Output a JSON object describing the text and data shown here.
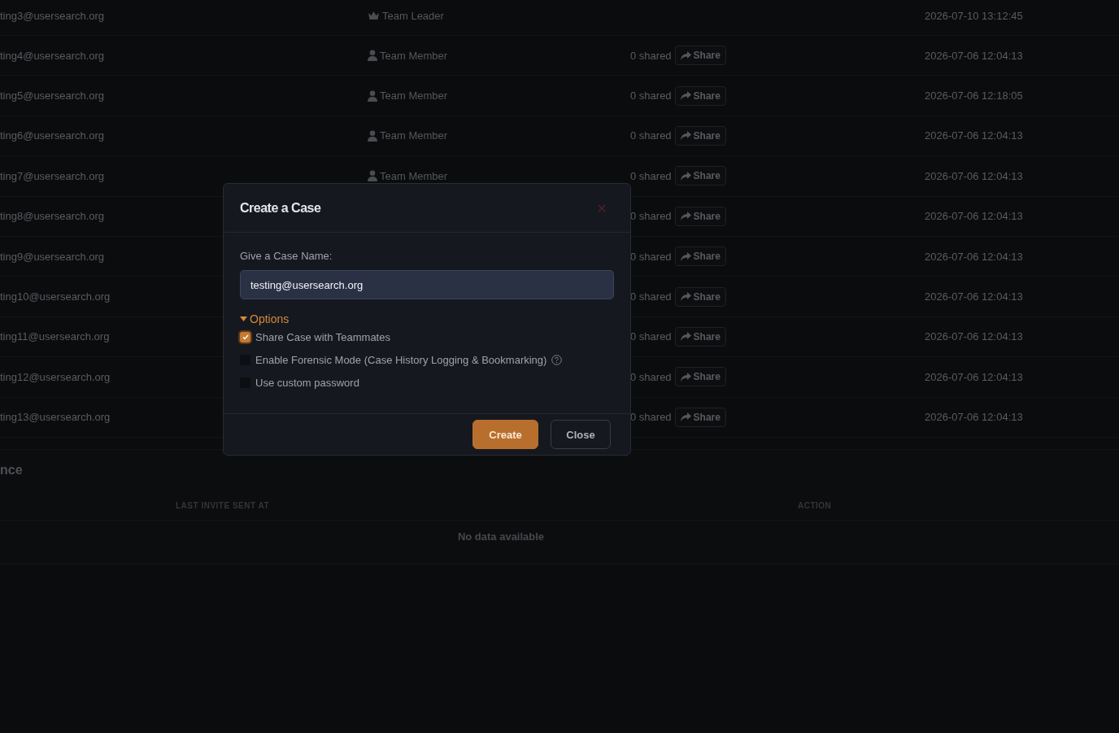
{
  "members": [
    {
      "email": "ting3@usersearch.org",
      "role": {
        "kind": "leader",
        "label": "Team Leader"
      },
      "date": "2026-07-10 13:12:45"
    },
    {
      "email": "ting4@usersearch.org",
      "role": {
        "kind": "member",
        "label": "Team Member"
      },
      "shared": "0 shared",
      "share_button": "Share",
      "date": "2026-07-06 12:04:13"
    },
    {
      "email": "ting5@usersearch.org",
      "role": {
        "kind": "member",
        "label": "Team Member"
      },
      "shared": "0 shared",
      "share_button": "Share",
      "date": "2026-07-06 12:18:05"
    },
    {
      "email": "ting6@usersearch.org",
      "role": {
        "kind": "member",
        "label": "Team Member"
      },
      "shared": "0 shared",
      "share_button": "Share",
      "date": "2026-07-06 12:04:13"
    },
    {
      "email": "ting7@usersearch.org",
      "role": {
        "kind": "member",
        "label": "Team Member"
      },
      "shared": "0 shared",
      "share_button": "Share",
      "date": "2026-07-06 12:04:13"
    },
    {
      "email": "ting8@usersearch.org",
      "shared": "0 shared",
      "share_button": "Share",
      "date": "2026-07-06 12:04:13"
    },
    {
      "email": "ting9@usersearch.org",
      "shared": "0 shared",
      "share_button": "Share",
      "date": "2026-07-06 12:04:13"
    },
    {
      "email": "ting10@usersearch.org",
      "shared": "0 shared",
      "share_button": "Share",
      "date": "2026-07-06 12:04:13"
    },
    {
      "email": "ting11@usersearch.org",
      "shared": "0 shared",
      "share_button": "Share",
      "date": "2026-07-06 12:04:13"
    },
    {
      "email": "ting12@usersearch.org",
      "shared": "0 shared",
      "share_button": "Share",
      "date": "2026-07-06 12:04:13"
    },
    {
      "email": "ting13@usersearch.org",
      "shared": "0 shared",
      "share_button": "Share",
      "date": "2026-07-06 12:04:13"
    }
  ],
  "invites": {
    "title": "nce",
    "columns": [
      "LAST INVITE SENT AT",
      "ACTION"
    ],
    "empty": "No data available"
  },
  "modal": {
    "title": "Create a Case",
    "field": {
      "label": "Give a Case Name:",
      "value": "testing@usersearch.org"
    },
    "options": {
      "label": "Options",
      "expanded": true,
      "items": [
        {
          "label": "Share Case with Teammates",
          "checked": true,
          "help": false
        },
        {
          "label": "Enable Forensic Mode (Case History Logging & Bookmarking)",
          "checked": false,
          "help": true
        },
        {
          "label": "Use custom password",
          "checked": false,
          "help": false
        }
      ]
    },
    "buttons": [
      {
        "kind": "primary",
        "label": "Create"
      },
      {
        "kind": "secondary",
        "label": "Close"
      }
    ]
  }
}
